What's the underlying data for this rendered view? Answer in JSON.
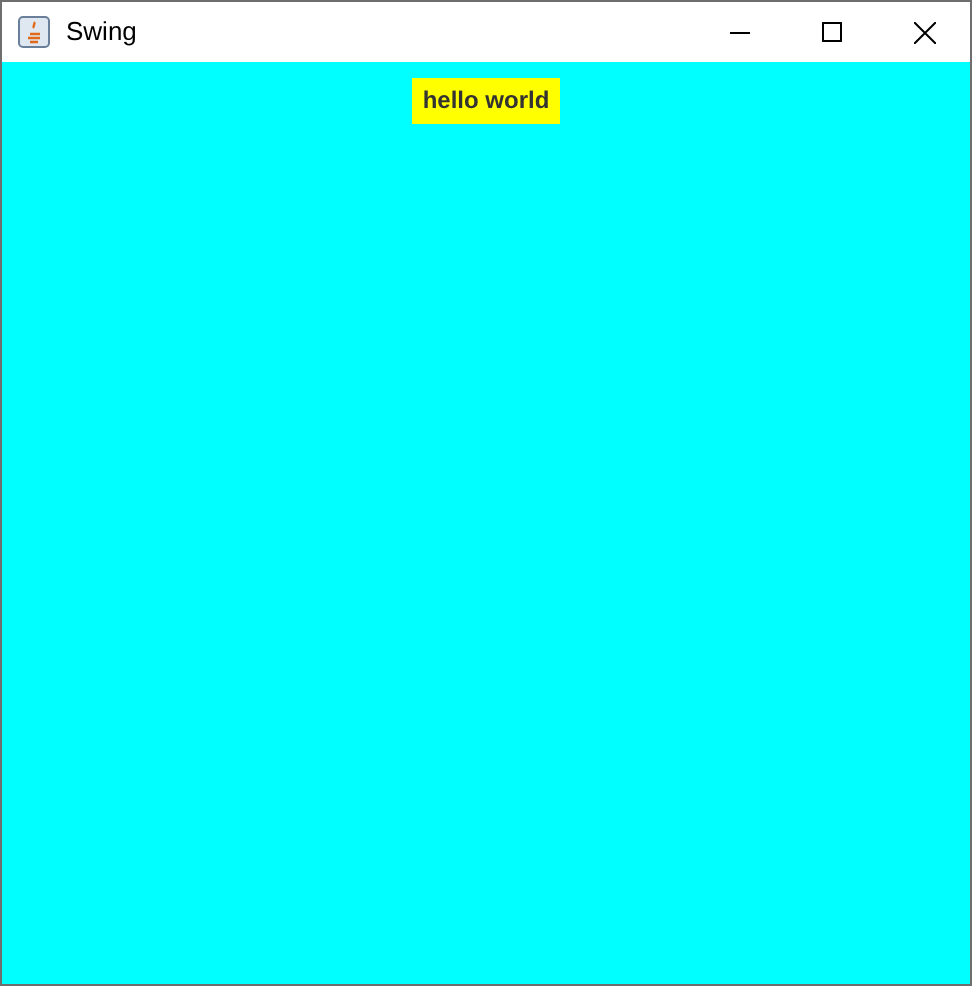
{
  "window": {
    "title": "Swing"
  },
  "label": {
    "text": "hello world"
  }
}
